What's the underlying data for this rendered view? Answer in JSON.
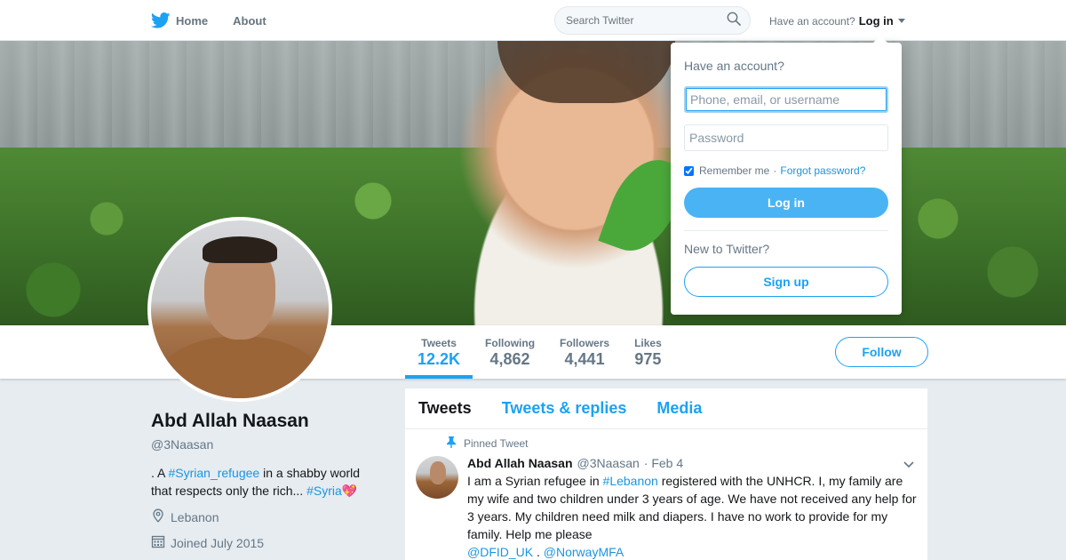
{
  "nav": {
    "home_label": "Home",
    "about_label": "About",
    "search_placeholder": "Search Twitter",
    "have_account": "Have an account?",
    "login_label": "Log in"
  },
  "profile": {
    "name": "Abd Allah Naasan",
    "handle": "@3Naasan",
    "bio_prefix": ". A",
    "bio_tag1": "#Syrian_refugee",
    "bio_mid": "in a shabby world that respects only the rich...",
    "bio_tag2": "#Syria",
    "bio_emoji": "💖",
    "location": "Lebanon",
    "joined": "Joined July 2015"
  },
  "stats": [
    {
      "label": "Tweets",
      "value": "12.2K"
    },
    {
      "label": "Following",
      "value": "4,862"
    },
    {
      "label": "Followers",
      "value": "4,441"
    },
    {
      "label": "Likes",
      "value": "975"
    }
  ],
  "follow_label": "Follow",
  "tabs": [
    "Tweets",
    "Tweets & replies",
    "Media"
  ],
  "tweet": {
    "pinned_label": "Pinned Tweet",
    "name": "Abd Allah Naasan",
    "handle": "@3Naasan",
    "time": "· Feb 4",
    "text_1": "I am a Syrian refugee in",
    "hashtag": "#Lebanon",
    "text_2": "registered with the UNHCR. I, my family are my wife and two children under 3 years of age. We have not received any help for 3 years. My children need milk and diapers. I have no work to provide for my family. Help me please",
    "mention1": "@DFID_UK",
    "dot": ".",
    "mention2": "@NorwayMFA"
  },
  "login_dropdown": {
    "title": "Have an account?",
    "username_placeholder": "Phone, email, or username",
    "password_placeholder": "Password",
    "remember_label": "Remember me",
    "separator": "·",
    "forgot_label": "Forgot password?",
    "login_button": "Log in",
    "new_label": "New to Twitter?",
    "signup_button": "Sign up"
  },
  "colors": {
    "accent": "#1da1f2",
    "background": "#e6ecf0"
  }
}
